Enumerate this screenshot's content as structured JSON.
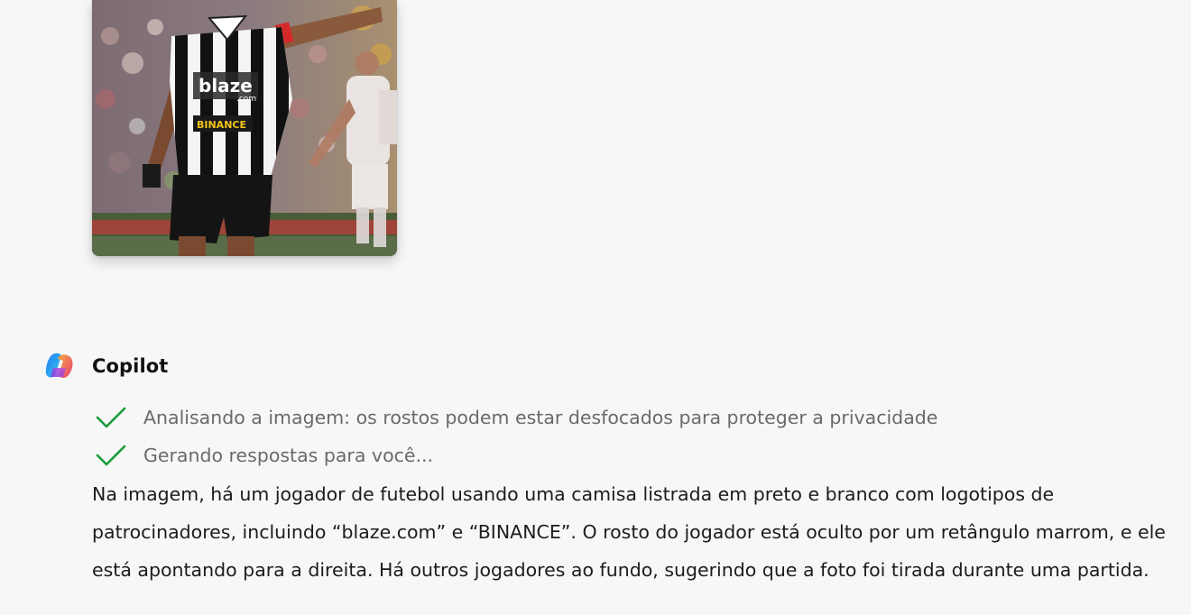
{
  "uploaded_image": {
    "jersey_sponsor_1": "blaze",
    "jersey_sponsor_1_sub": ".com",
    "jersey_sponsor_2": "BINANCE"
  },
  "copilot": {
    "name": "Copilot",
    "logo_icon": "copilot-logo-icon"
  },
  "steps": [
    {
      "icon": "check-icon",
      "text": "Analisando a imagem: os rostos podem estar desfocados para proteger a privacidade"
    },
    {
      "icon": "check-icon",
      "text": "Gerando respostas para você..."
    }
  ],
  "answer": {
    "text": "Na imagem, há um jogador de futebol usando uma camisa listrada em preto e branco com logotipos de patrocinadores, incluindo “blaze.com” e “BINANCE”. O rosto do jogador está oculto por um retângulo marrom, e ele está apontando para a direita. Há outros jogadores ao fundo, sugerindo que a foto foi tirada durante uma partida."
  },
  "colors": {
    "background": "#f7f7f7",
    "check": "#1a9b3c",
    "step_text": "#6a6a6a",
    "answer_text": "#1c1c1c"
  }
}
